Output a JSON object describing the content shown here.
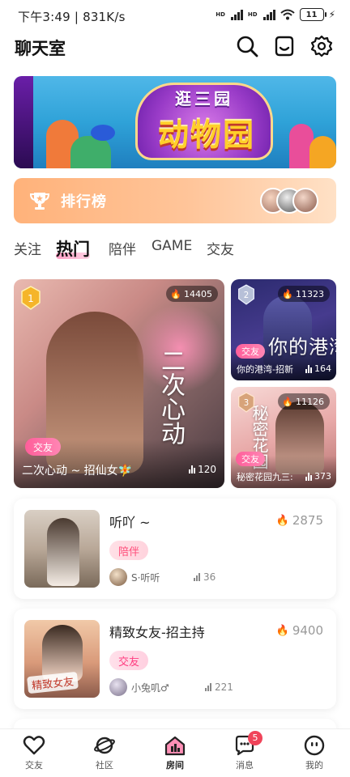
{
  "status_bar": {
    "time": "下午3:49 | 831K/s",
    "battery": "11"
  },
  "header": {
    "title": "聊天室"
  },
  "banner": {
    "line1": "逛三园",
    "line2": "动物园"
  },
  "ranking": {
    "label": "排行榜"
  },
  "tabs": [
    {
      "label": "关注",
      "active": false
    },
    {
      "label": "热门",
      "active": true
    },
    {
      "label": "陪伴",
      "active": false
    },
    {
      "label": "GAME",
      "active": false
    },
    {
      "label": "交友",
      "active": false
    }
  ],
  "featured": [
    {
      "rank": "1",
      "heat": "14405",
      "tag": "交友",
      "title": "二次心动 ~ 招仙女🧚",
      "viewers": "120",
      "art_text": "二次心动"
    },
    {
      "rank": "2",
      "heat": "11323",
      "tag": "交友",
      "title": "你的港湾-招新",
      "viewers": "164",
      "art_text": "你的港湾"
    },
    {
      "rank": "3",
      "heat": "11126",
      "tag": "交友",
      "title": "秘密花园九三:",
      "viewers": "373",
      "art_text": "秘密花园"
    }
  ],
  "rooms": [
    {
      "name": "听吖 ~",
      "heat": "2875",
      "tag": "陪伴",
      "owner": "S·听听",
      "viewers": "36",
      "tag_color": "#ff7a4d"
    },
    {
      "name": "精致女友-招主持",
      "heat": "9400",
      "tag": "交友",
      "owner": "小兔叽♂",
      "viewers": "221",
      "thumb_text": "精致女友",
      "tag_color": "#ff4d8a"
    }
  ],
  "bottom_nav": [
    {
      "label": "交友",
      "icon": "heart-icon"
    },
    {
      "label": "社区",
      "icon": "planet-icon"
    },
    {
      "label": "房间",
      "icon": "house-icon",
      "active": true
    },
    {
      "label": "消息",
      "icon": "chat-icon",
      "badge": "5"
    },
    {
      "label": "我的",
      "icon": "face-icon"
    }
  ],
  "colors": {
    "accent_pink": "#ff5e9a",
    "rank_orange": "#ffb27a",
    "flame": "#ff4d5e"
  }
}
